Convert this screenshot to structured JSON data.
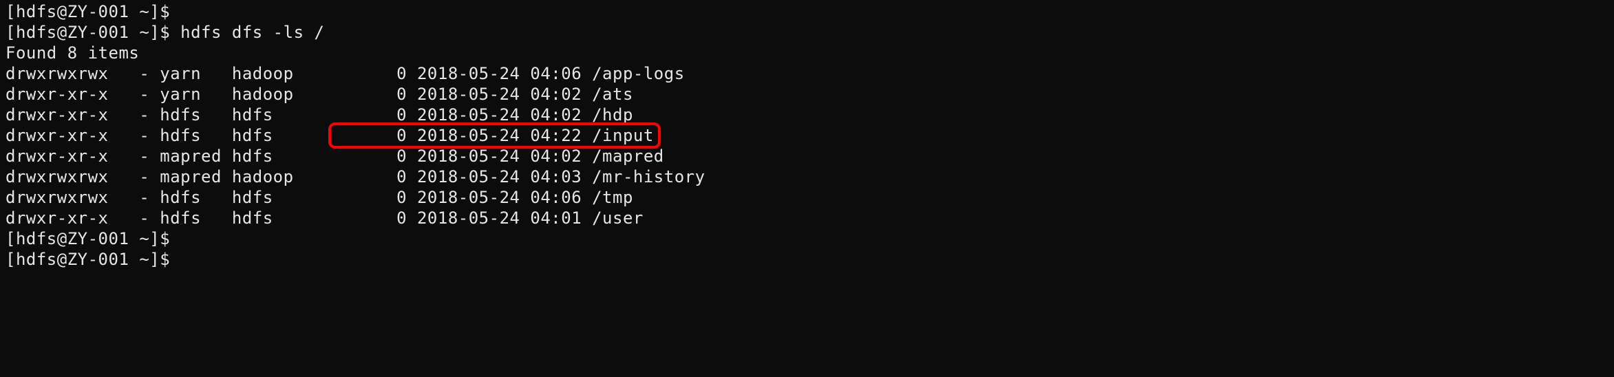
{
  "prompt": {
    "user": "hdfs",
    "at": "@",
    "host": "ZY-001",
    "cwd": "~",
    "symbol": "$"
  },
  "commands": {
    "empty1": "",
    "ls": "hdfs dfs -ls /",
    "empty2": "",
    "empty3": ""
  },
  "output": {
    "found": "Found 8 items",
    "rows": [
      {
        "perm": "drwxrwxrwx",
        "rep": "-",
        "owner": "yarn",
        "group": "hadoop",
        "size": "0",
        "date": "2018-05-24",
        "time": "04:06",
        "path": "/app-logs",
        "hl": false
      },
      {
        "perm": "drwxr-xr-x",
        "rep": "-",
        "owner": "yarn",
        "group": "hadoop",
        "size": "0",
        "date": "2018-05-24",
        "time": "04:02",
        "path": "/ats",
        "hl": false
      },
      {
        "perm": "drwxr-xr-x",
        "rep": "-",
        "owner": "hdfs",
        "group": "hdfs",
        "size": "0",
        "date": "2018-05-24",
        "time": "04:02",
        "path": "/hdp",
        "hl": false
      },
      {
        "perm": "drwxr-xr-x",
        "rep": "-",
        "owner": "hdfs",
        "group": "hdfs",
        "size": "0",
        "date": "2018-05-24",
        "time": "04:22",
        "path": "/input",
        "hl": true
      },
      {
        "perm": "drwxr-xr-x",
        "rep": "-",
        "owner": "mapred",
        "group": "hdfs",
        "size": "0",
        "date": "2018-05-24",
        "time": "04:02",
        "path": "/mapred",
        "hl": false
      },
      {
        "perm": "drwxrwxrwx",
        "rep": "-",
        "owner": "mapred",
        "group": "hadoop",
        "size": "0",
        "date": "2018-05-24",
        "time": "04:03",
        "path": "/mr-history",
        "hl": false
      },
      {
        "perm": "drwxrwxrwx",
        "rep": "-",
        "owner": "hdfs",
        "group": "hdfs",
        "size": "0",
        "date": "2018-05-24",
        "time": "04:06",
        "path": "/tmp",
        "hl": false
      },
      {
        "perm": "drwxr-xr-x",
        "rep": "-",
        "owner": "hdfs",
        "group": "hdfs",
        "size": "0",
        "date": "2018-05-24",
        "time": "04:01",
        "path": "/user",
        "hl": false
      }
    ]
  },
  "colwidths": {
    "perm": 13,
    "rep": 2,
    "owner": 7,
    "group": 10,
    "size": 7,
    "date": 11,
    "time": 6
  }
}
